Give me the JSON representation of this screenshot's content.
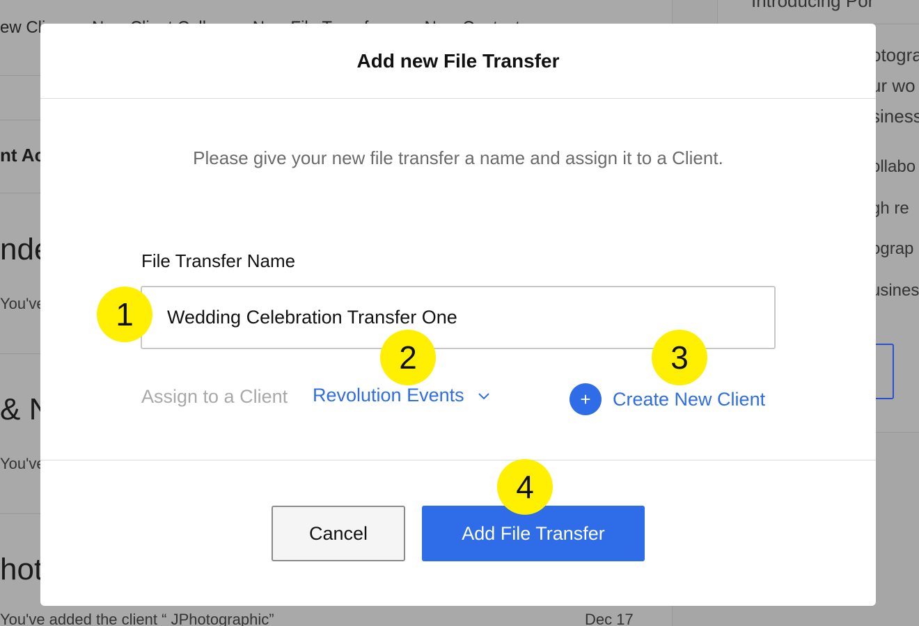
{
  "background": {
    "tabs": [
      "ew Cli",
      "New Client Coll",
      "New File Transfe",
      "New Contact"
    ],
    "section_title": "nt Ac",
    "sections": [
      {
        "title": "nde",
        "subtitle": "You've"
      },
      {
        "title": "& N",
        "subtitle": "You've"
      },
      {
        "title": "hoto",
        "subtitle": "You've added the client “ JPhotographic”",
        "date": "Dec 17"
      }
    ],
    "right_panel": {
      "heading": "Introducing Por",
      "lines": [
        "otogra",
        "ur wo",
        "siness",
        "ollabo",
        "gh re",
        "ograp",
        "usines"
      ]
    }
  },
  "modal": {
    "title": "Add new File Transfer",
    "intro": "Please give your new file transfer a name and assign it to a Client.",
    "field_label": "File Transfer Name",
    "name_value": "Wedding Celebration Transfer One",
    "assign_label": "Assign to a Client",
    "selected_client": "Revolution Events",
    "create_client_label": "Create New Client",
    "plus_icon": "+",
    "cancel_label": "Cancel",
    "submit_label": "Add File Transfer"
  },
  "callouts": [
    "1",
    "2",
    "3",
    "4"
  ],
  "colors": {
    "accent": "#2e6ce8",
    "callout": "#ffef00",
    "overlay": "#a6a6a6"
  }
}
